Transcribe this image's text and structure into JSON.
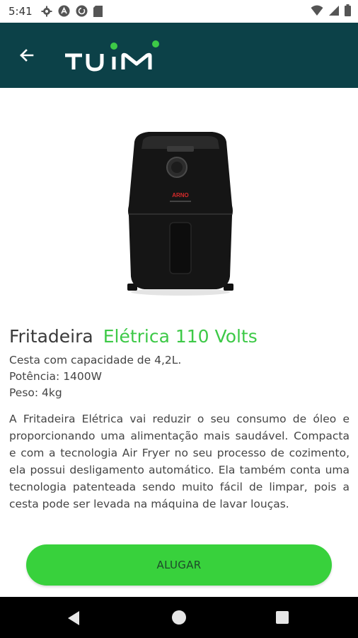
{
  "status_bar": {
    "time": "5:41",
    "left_icons": [
      "settings-icon",
      "a-circle-icon",
      "sync-circle-icon",
      "sd-card-icon"
    ],
    "right_icons": [
      "wifi-icon",
      "signal-icon",
      "battery-icon"
    ]
  },
  "app_bar": {
    "logo_text": "TUIM",
    "background_color": "#0c4148",
    "logo_dot_color": "#3dc947"
  },
  "product": {
    "image": "air-fryer-image",
    "brand_label": "ARNO",
    "title_main": "Fritadeira",
    "title_accent": "Elétrica 110 Volts",
    "specs": [
      "Cesta com capacidade de 4,2L.",
      "Potência: 1400W",
      "Peso: 4kg"
    ],
    "description": "A Fritadeira Elétrica vai reduzir o seu consumo de óleo e proporcionando uma alimentação mais saudável. Compacta e com a tecnologia Air Fryer no seu processo de cozimento, ela possui desligamento automático. Ela também conta uma tecnologia patenteada sendo muito fácil de limpar, pois a cesta pode ser levada na máquina de lavar louças."
  },
  "actions": {
    "rent_label": "ALUGAR",
    "rent_color": "#38d13c"
  },
  "nav_bar": {
    "buttons": [
      "back",
      "home",
      "recents"
    ]
  }
}
